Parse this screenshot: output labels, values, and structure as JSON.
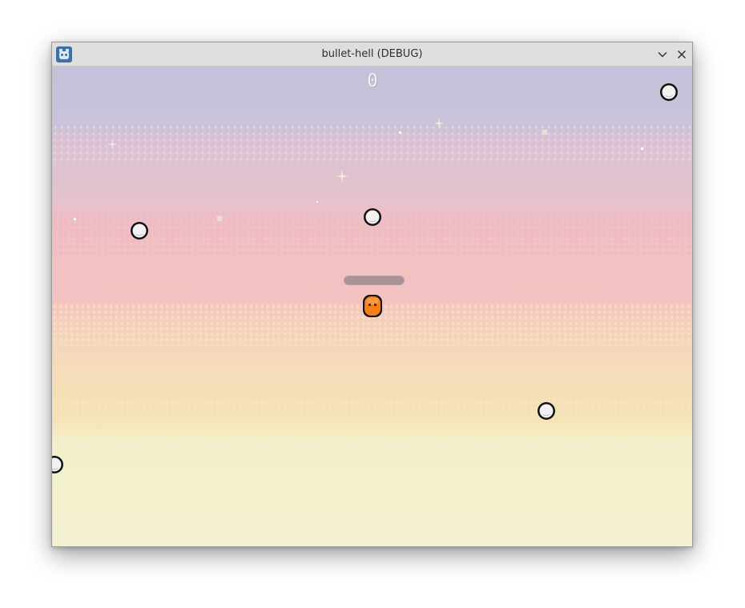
{
  "window": {
    "title": "bullet-hell (DEBUG)",
    "app_icon": "godot-icon",
    "controls": [
      "chevron-down-icon",
      "close-icon"
    ]
  },
  "hud": {
    "score": "0"
  },
  "colors": {
    "player": "#f47e1b",
    "bullet": "#e8e8e8",
    "outline": "#111111",
    "sky_top": "#c6c1da",
    "sky_pink": "#f0bfc4",
    "sky_bottom": "#f4f1d0"
  }
}
